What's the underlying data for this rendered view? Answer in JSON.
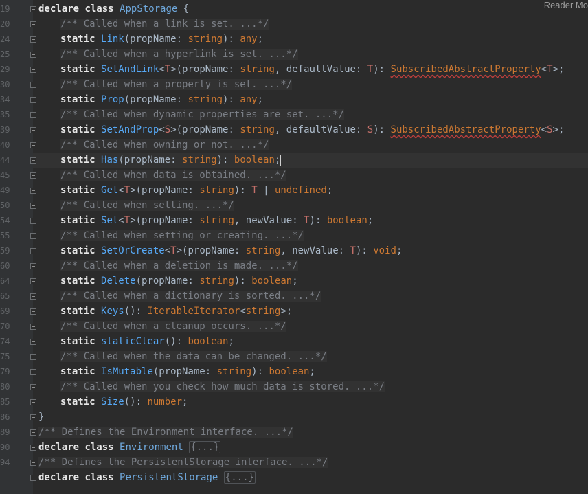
{
  "reader_mode_label": "Reader Mo",
  "line_numbers": [
    "19",
    "20",
    "24",
    "25",
    "29",
    "30",
    "34",
    "35",
    "39",
    "40",
    "44",
    "45",
    "49",
    "50",
    "54",
    "55",
    "59",
    "60",
    "64",
    "65",
    "69",
    "70",
    "74",
    "75",
    "79",
    "80",
    "85",
    "86",
    "89",
    "90",
    "94"
  ],
  "class_name": "AppStorage",
  "lines": [
    {
      "kind": "class_open",
      "decl": "declare",
      "cls_kw": "class",
      "name": "AppStorage",
      "brace": "{"
    },
    {
      "kind": "comment",
      "text": "/** Called when a link is set. ...*/"
    },
    {
      "kind": "method",
      "static": "static",
      "name": "Link",
      "sig_parts": [
        {
          "t": "p",
          "v": "(propName: "
        },
        {
          "t": "type",
          "v": "string"
        },
        {
          "t": "p",
          "v": "): "
        },
        {
          "t": "type",
          "v": "any"
        },
        {
          "t": "p",
          "v": ";"
        }
      ]
    },
    {
      "kind": "comment",
      "text": "/** Called when a hyperlink is set. ...*/"
    },
    {
      "kind": "method",
      "static": "static",
      "name": "SetAndLink",
      "sig_parts": [
        {
          "t": "p",
          "v": "<"
        },
        {
          "t": "tp",
          "v": "T"
        },
        {
          "t": "p",
          "v": ">(propName: "
        },
        {
          "t": "type",
          "v": "string"
        },
        {
          "t": "p",
          "v": ", defaultValue: "
        },
        {
          "t": "tp",
          "v": "T"
        },
        {
          "t": "p",
          "v": "): "
        },
        {
          "t": "err",
          "v": "SubscribedAbstractProperty"
        },
        {
          "t": "p",
          "v": "<"
        },
        {
          "t": "tp",
          "v": "T"
        },
        {
          "t": "p",
          "v": ">;"
        }
      ]
    },
    {
      "kind": "comment",
      "text": "/** Called when a property is set. ...*/"
    },
    {
      "kind": "method",
      "static": "static",
      "name": "Prop",
      "sig_parts": [
        {
          "t": "p",
          "v": "(propName: "
        },
        {
          "t": "type",
          "v": "string"
        },
        {
          "t": "p",
          "v": "): "
        },
        {
          "t": "type",
          "v": "any"
        },
        {
          "t": "p",
          "v": ";"
        }
      ]
    },
    {
      "kind": "comment",
      "text": "/** Called when dynamic properties are set. ...*/"
    },
    {
      "kind": "method",
      "static": "static",
      "name": "SetAndProp",
      "sig_parts": [
        {
          "t": "p",
          "v": "<"
        },
        {
          "t": "tp",
          "v": "S"
        },
        {
          "t": "p",
          "v": ">(propName: "
        },
        {
          "t": "type",
          "v": "string"
        },
        {
          "t": "p",
          "v": ", defaultValue: "
        },
        {
          "t": "tp",
          "v": "S"
        },
        {
          "t": "p",
          "v": "): "
        },
        {
          "t": "err",
          "v": "SubscribedAbstractProperty"
        },
        {
          "t": "p",
          "v": "<"
        },
        {
          "t": "tp",
          "v": "S"
        },
        {
          "t": "p",
          "v": ">;"
        }
      ]
    },
    {
      "kind": "comment",
      "text": "/** Called when owning or not. ...*/"
    },
    {
      "kind": "method",
      "static": "static",
      "name": "Has",
      "current": true,
      "sig_parts": [
        {
          "t": "p",
          "v": "(propName: "
        },
        {
          "t": "type",
          "v": "string"
        },
        {
          "t": "p",
          "v": "): "
        },
        {
          "t": "type",
          "v": "boolean"
        },
        {
          "t": "p",
          "v": ";"
        }
      ]
    },
    {
      "kind": "comment",
      "text": "/** Called when data is obtained. ...*/"
    },
    {
      "kind": "method",
      "static": "static",
      "name": "Get",
      "sig_parts": [
        {
          "t": "p",
          "v": "<"
        },
        {
          "t": "tp",
          "v": "T"
        },
        {
          "t": "p",
          "v": ">(propName: "
        },
        {
          "t": "type",
          "v": "string"
        },
        {
          "t": "p",
          "v": "): "
        },
        {
          "t": "tp",
          "v": "T"
        },
        {
          "t": "p",
          "v": " | "
        },
        {
          "t": "type",
          "v": "undefined"
        },
        {
          "t": "p",
          "v": ";"
        }
      ]
    },
    {
      "kind": "comment",
      "text": "/** Called when setting. ...*/"
    },
    {
      "kind": "method",
      "static": "static",
      "name": "Set",
      "sig_parts": [
        {
          "t": "p",
          "v": "<"
        },
        {
          "t": "tp",
          "v": "T"
        },
        {
          "t": "p",
          "v": ">(propName: "
        },
        {
          "t": "type",
          "v": "string"
        },
        {
          "t": "p",
          "v": ", newValue: "
        },
        {
          "t": "tp",
          "v": "T"
        },
        {
          "t": "p",
          "v": "): "
        },
        {
          "t": "type",
          "v": "boolean"
        },
        {
          "t": "p",
          "v": ";"
        }
      ]
    },
    {
      "kind": "comment",
      "text": "/** Called when setting or creating. ...*/"
    },
    {
      "kind": "method",
      "static": "static",
      "name": "SetOrCreate",
      "sig_parts": [
        {
          "t": "p",
          "v": "<"
        },
        {
          "t": "tp",
          "v": "T"
        },
        {
          "t": "p",
          "v": ">(propName: "
        },
        {
          "t": "type",
          "v": "string"
        },
        {
          "t": "p",
          "v": ", newValue: "
        },
        {
          "t": "tp",
          "v": "T"
        },
        {
          "t": "p",
          "v": "): "
        },
        {
          "t": "type",
          "v": "void"
        },
        {
          "t": "p",
          "v": ";"
        }
      ]
    },
    {
      "kind": "comment",
      "text": "/** Called when a deletion is made. ...*/"
    },
    {
      "kind": "method",
      "static": "static",
      "name": "Delete",
      "sig_parts": [
        {
          "t": "p",
          "v": "(propName: "
        },
        {
          "t": "type",
          "v": "string"
        },
        {
          "t": "p",
          "v": "): "
        },
        {
          "t": "type",
          "v": "boolean"
        },
        {
          "t": "p",
          "v": ";"
        }
      ]
    },
    {
      "kind": "comment",
      "text": "/** Called when a dictionary is sorted. ...*/"
    },
    {
      "kind": "method",
      "static": "static",
      "name": "Keys",
      "sig_parts": [
        {
          "t": "p",
          "v": "(): "
        },
        {
          "t": "type",
          "v": "IterableIterator"
        },
        {
          "t": "p",
          "v": "<"
        },
        {
          "t": "type",
          "v": "string"
        },
        {
          "t": "p",
          "v": ">;"
        }
      ]
    },
    {
      "kind": "comment",
      "text": "/** Called when a cleanup occurs. ...*/"
    },
    {
      "kind": "method",
      "static": "static",
      "name": "staticClear",
      "sig_parts": [
        {
          "t": "p",
          "v": "(): "
        },
        {
          "t": "type",
          "v": "boolean"
        },
        {
          "t": "p",
          "v": ";"
        }
      ]
    },
    {
      "kind": "comment",
      "text": "/** Called when the data can be changed. ...*/"
    },
    {
      "kind": "method",
      "static": "static",
      "name": "IsMutable",
      "sig_parts": [
        {
          "t": "p",
          "v": "(propName: "
        },
        {
          "t": "type",
          "v": "string"
        },
        {
          "t": "p",
          "v": "): "
        },
        {
          "t": "type",
          "v": "boolean"
        },
        {
          "t": "p",
          "v": ";"
        }
      ]
    },
    {
      "kind": "comment",
      "text": "/** Called when you check how much data is stored. ...*/"
    },
    {
      "kind": "method",
      "static": "static",
      "name": "Size",
      "sig_parts": [
        {
          "t": "p",
          "v": "(): "
        },
        {
          "t": "type",
          "v": "number"
        },
        {
          "t": "p",
          "v": ";"
        }
      ]
    },
    {
      "kind": "close",
      "text": "}"
    },
    {
      "kind": "top_comment",
      "text": "/** Defines the Environment interface. ...*/"
    },
    {
      "kind": "class_collapsed",
      "decl": "declare",
      "cls_kw": "class",
      "name": "Environment",
      "body": "{...}"
    },
    {
      "kind": "top_comment",
      "text": "/** Defines the PersistentStorage interface. ...*/"
    },
    {
      "kind": "class_collapsed",
      "decl": "declare",
      "cls_kw": "class",
      "name": "PersistentStorage",
      "body": "{...}"
    }
  ],
  "colors": {
    "background": "#2b2b2b",
    "gutter": "#313335",
    "keyword": "#cc7832",
    "function": "#56a8f5",
    "comment": "#7a7e85",
    "error_underline": "#bc3f3c"
  }
}
